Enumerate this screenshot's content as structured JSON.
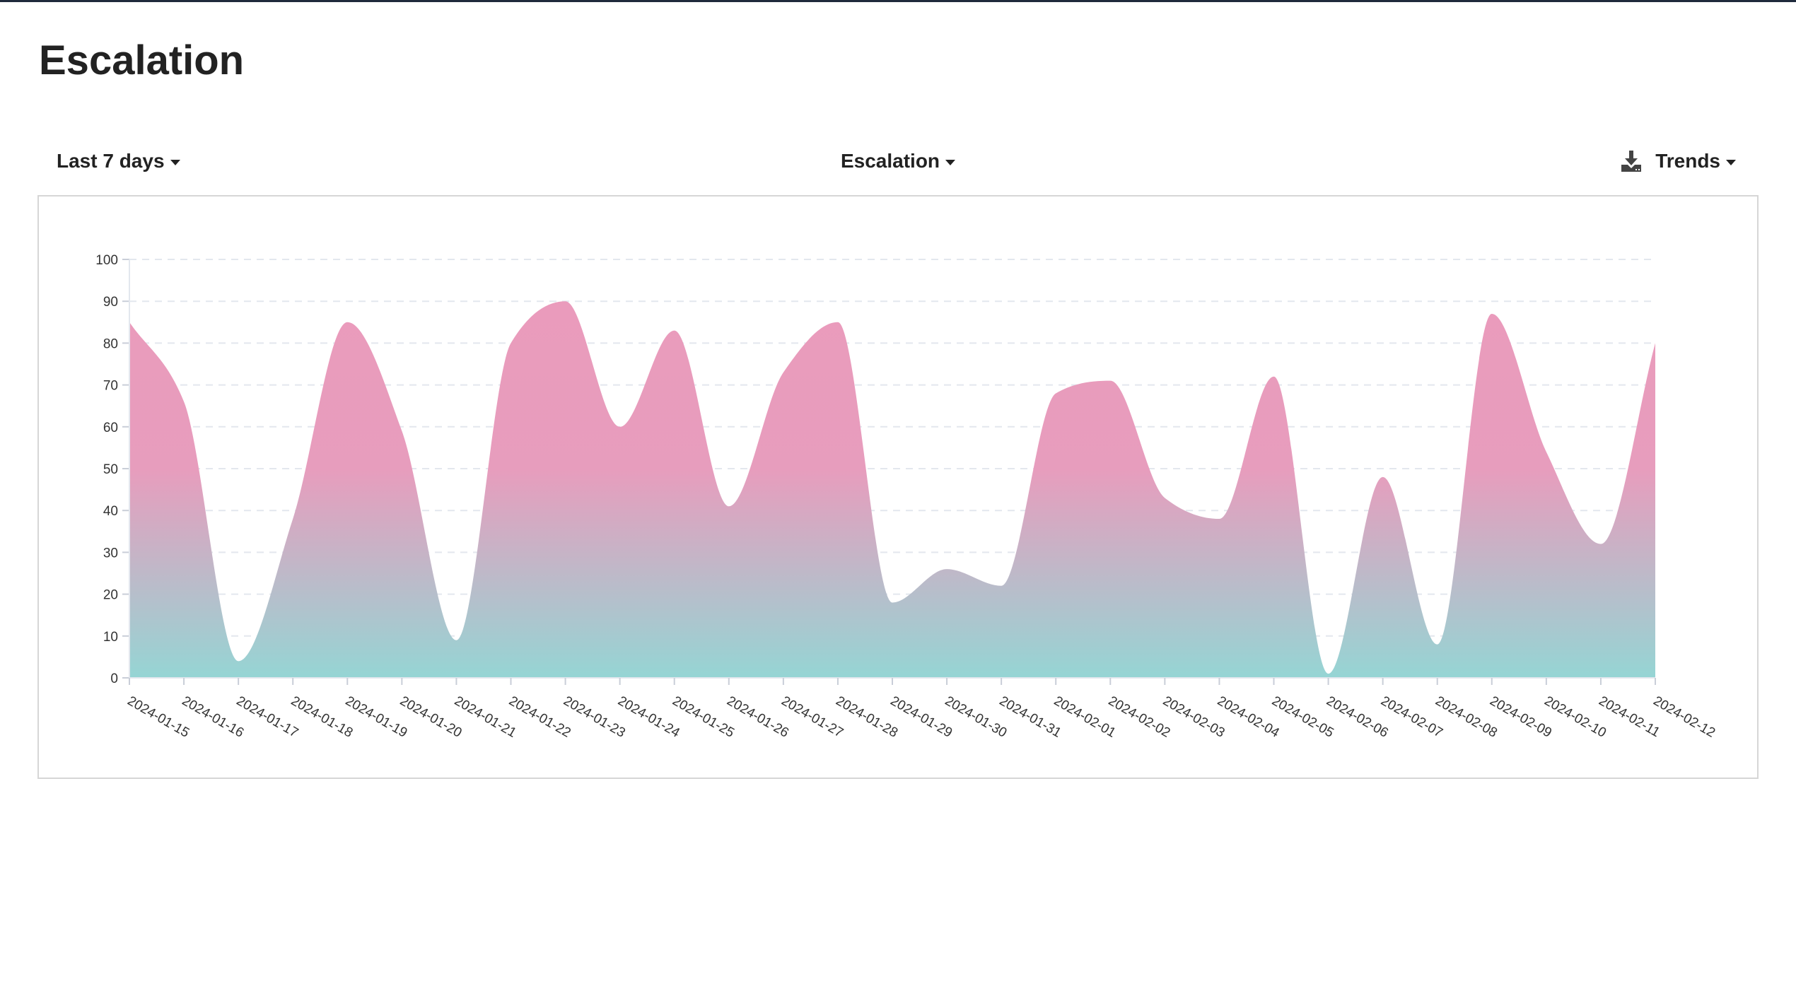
{
  "page": {
    "title": "Escalation"
  },
  "toolbar": {
    "range_label": "Last 7 days",
    "metric_label": "Escalation",
    "view_label": "Trends",
    "download_icon": "download-icon",
    "caret_icon": "caret-down-icon"
  },
  "colors": {
    "top_bar": "#1f2a3c",
    "area_top": "#ea9bbc",
    "area_bottom": "#95d5d4",
    "gridline": "#e3e7ee",
    "card_border": "#d6d6d6"
  },
  "chart_data": {
    "type": "area",
    "title": "",
    "xlabel": "",
    "ylabel": "",
    "ylim": [
      0,
      100
    ],
    "yticks": [
      0,
      10,
      20,
      30,
      40,
      50,
      60,
      70,
      80,
      90,
      100
    ],
    "grid": true,
    "legend": "none",
    "smooth": true,
    "x": [
      "2024-01-15",
      "2024-01-16",
      "2024-01-17",
      "2024-01-18",
      "2024-01-19",
      "2024-01-20",
      "2024-01-21",
      "2024-01-22",
      "2024-01-23",
      "2024-01-24",
      "2024-01-25",
      "2024-01-26",
      "2024-01-27",
      "2024-01-28",
      "2024-01-29",
      "2024-01-30",
      "2024-01-31",
      "2024-02-01",
      "2024-02-02",
      "2024-02-03",
      "2024-02-04",
      "2024-02-05",
      "2024-02-06",
      "2024-02-07",
      "2024-02-08",
      "2024-02-09",
      "2024-02-10",
      "2024-02-11",
      "2024-02-12"
    ],
    "series": [
      {
        "name": "Escalation",
        "values": [
          85,
          66,
          4,
          38,
          85,
          59,
          9,
          80,
          90,
          60,
          83,
          41,
          73,
          85,
          18,
          26,
          22,
          68,
          71,
          43,
          38,
          72,
          1,
          48,
          8,
          87,
          54,
          32,
          80
        ]
      }
    ]
  }
}
